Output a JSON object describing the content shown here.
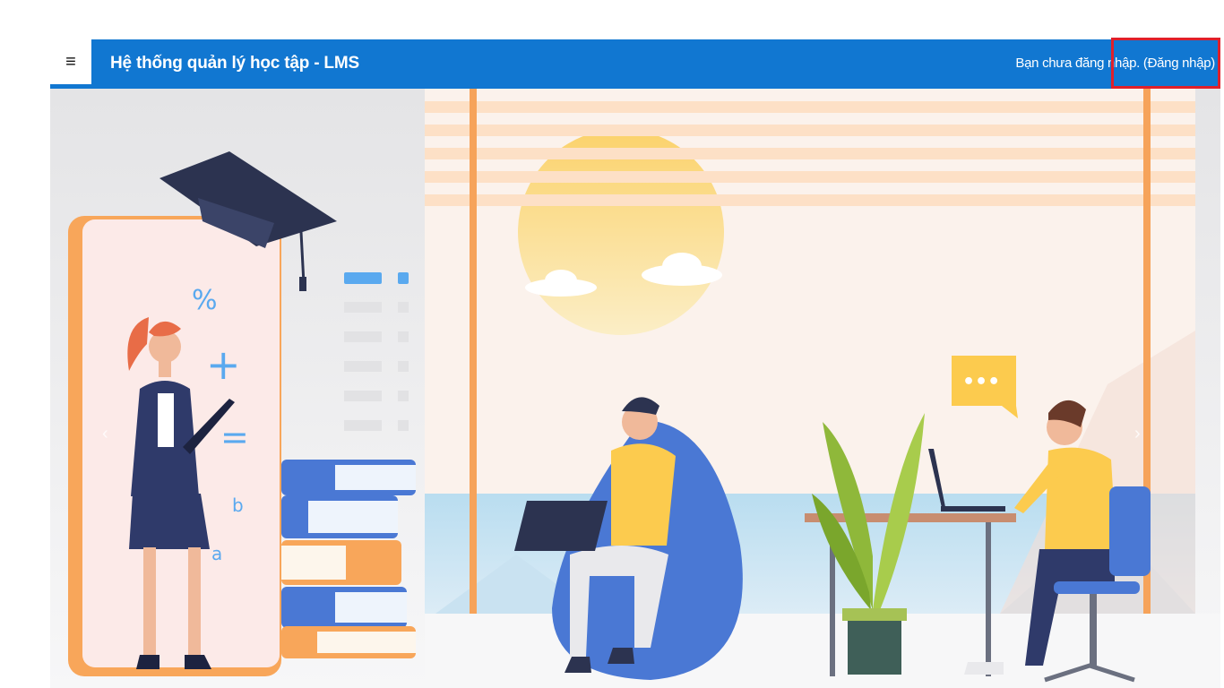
{
  "header": {
    "menu_icon": "hamburger-icon",
    "menu_glyph": "≡",
    "title": "Hệ thống quản lý học tập - LMS",
    "status_text": "Bạn chưa đăng nhập. ",
    "login_link": "(Đăng nhập)"
  },
  "hero": {
    "letters": {
      "percent": "%",
      "plus": "+",
      "equals": "=",
      "b": "b",
      "a": "a"
    },
    "chat_bubble": "•••",
    "prev_icon": "chevron-left-icon",
    "next_icon": "chevron-right-icon",
    "prev_glyph": "‹",
    "next_glyph": "›"
  },
  "colors": {
    "navbar": "#1177d1",
    "highlight": "#e0202a",
    "accent_orange": "#f5923e",
    "accent_blue": "#4a78d4"
  }
}
